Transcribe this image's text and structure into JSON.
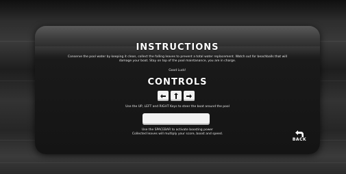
{
  "instructions": {
    "title": "INSTRUCTIONS",
    "description": "Conserve the pool water by keeping it clean, collect the falling leaves to prevent a total water replacement. Watch out for beachballs that will damage your boat. Stay on top of the pool maintanance, you are in charge.",
    "good_luck": "Good Luck!"
  },
  "controls": {
    "title": "CONTROLS",
    "keys": [
      {
        "icon": "arrow-left-icon"
      },
      {
        "icon": "arrow-up-icon"
      },
      {
        "icon": "arrow-right-icon"
      }
    ],
    "arrow_text": "Use the UP, LEFT and RIGHT Keys to steer the boat around the pool",
    "spacebar_text": "Use the SPACEBAR to activate boosting power",
    "leaves_text": "Collected leaves will multiply your score, boost and speed."
  },
  "back": {
    "label": "BACK",
    "icon": "back-arrow-icon"
  }
}
